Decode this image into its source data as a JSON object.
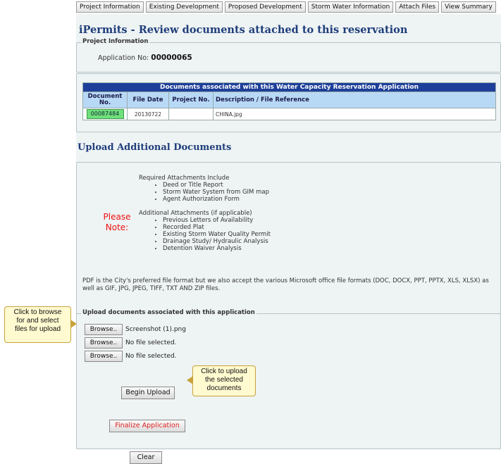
{
  "nav": {
    "tabs": [
      "Project Information",
      "Existing Development",
      "Proposed Development",
      "Storm Water Information",
      "Attach Files",
      "View Summary"
    ]
  },
  "page_title": "iPermits - Review documents attached to this reservation",
  "project_info": {
    "legend": "Project Information",
    "application_label": "Application No:",
    "application_no": "00000065"
  },
  "documents": {
    "title": "Documents associated with this Water Capacity Reservation Application",
    "columns": [
      "Document No.",
      "File Date",
      "Project No.",
      "Description / File Reference"
    ],
    "rows": [
      {
        "doc_no": "00087484",
        "file_date": "20130722",
        "project_no": "",
        "description": "CHINA.jpg"
      }
    ]
  },
  "upload_title": "Upload Additional Documents",
  "note": {
    "label_line1": "Please",
    "label_line2": "Note:",
    "required_heading": "Required Attachments Include",
    "required_items": [
      "Deed or Title Report",
      "Storm Water System from GIM map",
      "Agent Authorization Form"
    ],
    "additional_heading": "Additional Attachments (if applicable)",
    "additional_items": [
      "Previous Letters of Availability",
      "Recorded Plat",
      "Existing Storm Water Quality Permit",
      "Drainage Study/ Hydraulic Analysis",
      "Detention Waiver Analysis"
    ],
    "footer": "PDF is the City's preferred file format but we also accept the various Microsoft office file formats (DOC, DOCX, PPT, PPTX, XLS, XLSX) as well as GIF, JPG, JPEG, TIFF, TXT AND ZIP files."
  },
  "upload": {
    "legend": "Upload documents associated with this application",
    "browse_label": "Browse..",
    "files": [
      "Screenshot (1).png",
      "No file selected.",
      "No file selected."
    ],
    "begin_upload": "Begin Upload",
    "finalize": "Finalize Application",
    "clear": "Clear"
  },
  "callouts": {
    "browse_tip_line1": "Click to browse",
    "browse_tip_line2": "for and select",
    "browse_tip_line3": "files for upload",
    "upload_tip_line1": "Click to upload",
    "upload_tip_line2": "the selected",
    "upload_tip_line3": "documents"
  },
  "colors": {
    "title_blue": "#1f3e7a",
    "table_header": "#1e3f99",
    "doc_link_green": "#6fe07c",
    "note_red": "#ee1111"
  }
}
